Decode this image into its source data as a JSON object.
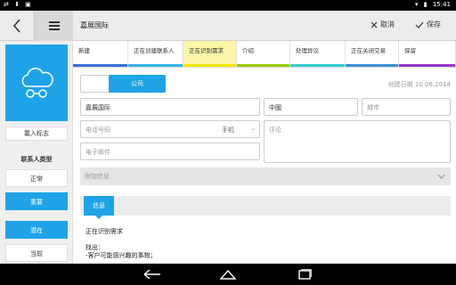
{
  "status_bar": {
    "left_icons": "⇄ ⬇ ▣",
    "time": "15:41"
  },
  "header": {
    "title": "嘉展国际",
    "cancel_label": "取消",
    "save_label": "保存"
  },
  "sidebar": {
    "load_logo_label": "載入标志",
    "contact_type_label": "联系人类型",
    "types": [
      {
        "label": "正常",
        "active": false
      },
      {
        "label": "重要",
        "active": true
      },
      {
        "label": "潜在",
        "active": true
      },
      {
        "label": "当前",
        "active": false
      }
    ]
  },
  "stages": [
    {
      "label": "新建",
      "color": "#3b6fd6"
    },
    {
      "label": "正在创建联系人",
      "color": "#33b5e5"
    },
    {
      "label": "正在识别需求",
      "color": "#f2e600",
      "selected": true
    },
    {
      "label": "介绍",
      "color": "#99cc00"
    },
    {
      "label": "处理异议",
      "color": "#33cccc"
    },
    {
      "label": "正在关闭交易",
      "color": "#3b8fd6"
    },
    {
      "label": "保留",
      "color": "#9933cc"
    }
  ],
  "form": {
    "toggle_label": "公司",
    "created_date": "创建日期 10.06.2014",
    "company_name": "嘉展国际",
    "country": "中國",
    "city_placeholder": "城市",
    "phone_placeholder": "电话号码",
    "phone_type": "手机",
    "comment_placeholder": "评论",
    "email_placeholder": "电子邮件",
    "extra_info_placeholder": "附加信息"
  },
  "info": {
    "tab_label": "信息",
    "stage_title": "正在识别需求",
    "find_label": "找出：",
    "find_item": "-客户可能感兴趣的事物；"
  },
  "colors": {
    "accent": "#1ea4e6"
  }
}
